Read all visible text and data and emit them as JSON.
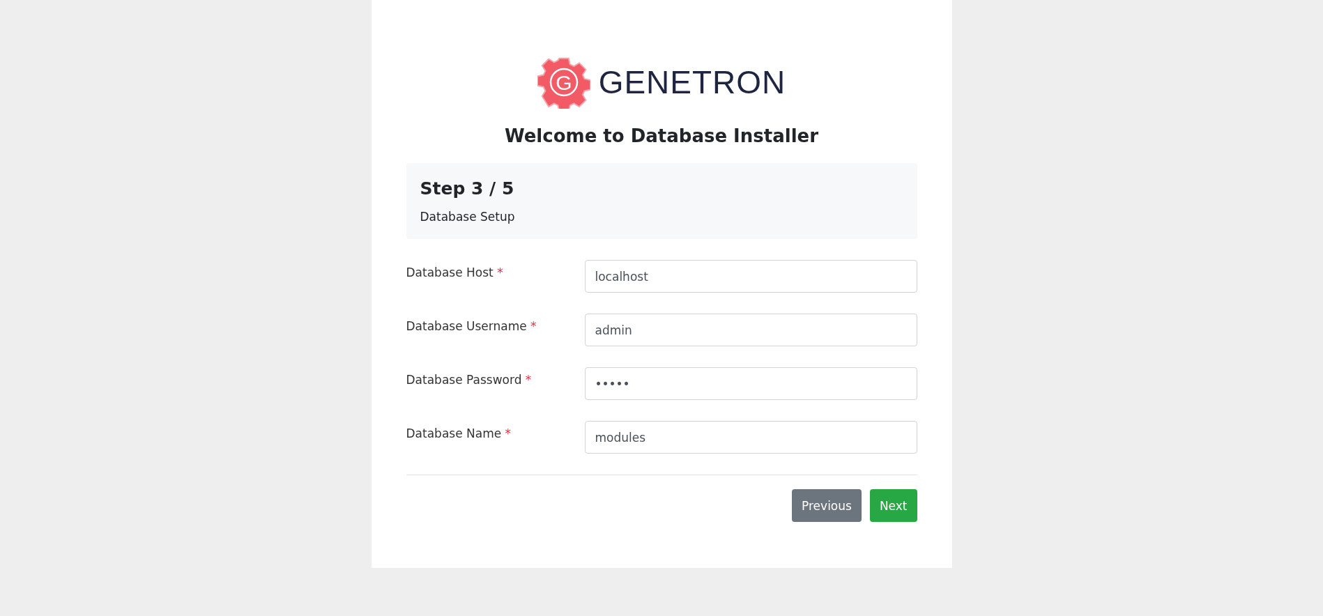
{
  "logo": {
    "letter": "G",
    "name": "GENETRON"
  },
  "title": "Welcome to Database Installer",
  "step": {
    "heading": "Step 3 / 5",
    "subtitle": "Database Setup"
  },
  "fields": [
    {
      "label": "Database Host",
      "required_mark": "*",
      "value": "localhost"
    },
    {
      "label": "Database Username",
      "required_mark": "*",
      "value": "admin"
    },
    {
      "label": "Database Password",
      "required_mark": "*",
      "value": "•••••"
    },
    {
      "label": "Database Name",
      "required_mark": "*",
      "value": "modules"
    }
  ],
  "buttons": [
    {
      "label": "Previous",
      "kind": "secondary"
    },
    {
      "label": "Next",
      "kind": "primary"
    }
  ]
}
